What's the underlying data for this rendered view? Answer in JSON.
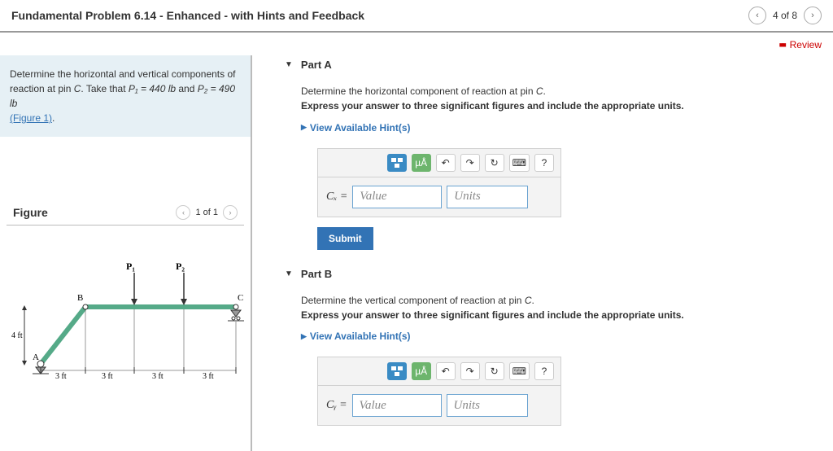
{
  "header": {
    "title": "Fundamental Problem 6.14 - Enhanced - with Hints and Feedback",
    "page_indicator": "4 of 8"
  },
  "review_link": "Review",
  "intro": {
    "text_before": "Determine the horizontal and vertical components of reaction at pin ",
    "pinC": "C",
    "text_mid": ". Take that ",
    "p1_expr": "P₁ = 440 lb",
    "and": " and ",
    "p2_expr": "P₂ = 490 lb",
    "figure_link": "(Figure 1)",
    "period": "."
  },
  "figure": {
    "title": "Figure",
    "counter": "1 of 1"
  },
  "partA": {
    "label": "Part A",
    "prompt1_a": "Determine the horizontal component of reaction at pin ",
    "prompt1_b": "C",
    "prompt1_c": ".",
    "prompt2": "Express your answer to three significant figures and include the appropriate units.",
    "hints": "View Available Hint(s)",
    "var": "Cₓ =",
    "value_ph": "Value",
    "units_ph": "Units",
    "submit": "Submit",
    "special_label": "µÅ",
    "help": "?"
  },
  "partB": {
    "label": "Part B",
    "prompt1_a": "Determine the vertical component of reaction at pin ",
    "prompt1_b": "C",
    "prompt1_c": ".",
    "prompt2": "Express your answer to three significant figures and include the appropriate units.",
    "hints": "View Available Hint(s)",
    "var": "Cᵧ =",
    "value_ph": "Value",
    "units_ph": "Units",
    "special_label": "µÅ",
    "help": "?"
  },
  "diagram": {
    "p1": "P₁",
    "p2": "P₂",
    "A": "A",
    "B": "B",
    "C": "C",
    "h": "4 ft",
    "d1": "3 ft",
    "d2": "3 ft",
    "d3": "3 ft",
    "d4": "3 ft"
  }
}
